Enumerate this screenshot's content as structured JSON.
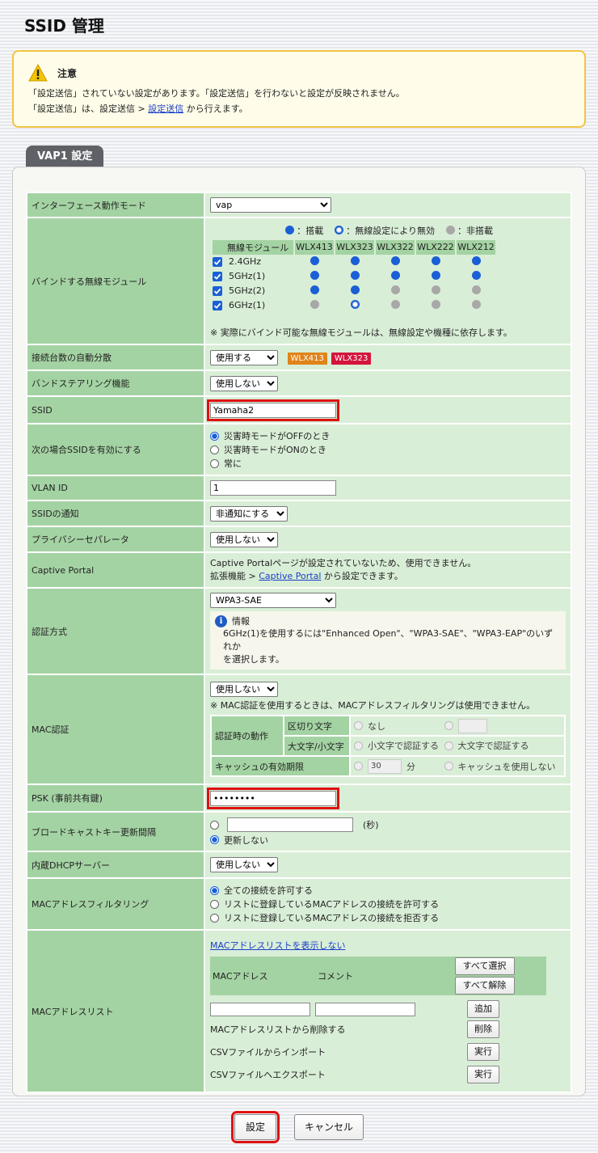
{
  "title": "SSID 管理",
  "notice": {
    "title": "注意",
    "line1": "「設定送信」されていない設定があります。「設定送信」を行わないと設定が反映されません。",
    "line2_pre": "「設定送信」は、設定送信 > ",
    "line2_link": "設定送信",
    "line2_post": " から行えます。"
  },
  "tab": "VAP1 設定",
  "colors": {
    "accent": "#1a5fd6",
    "label_bg": "#a4d3a3",
    "value_bg": "#d9eed7",
    "highlight": "#e01010",
    "badge_orange": "#e0841a",
    "badge_red": "#d4143c"
  },
  "rows": {
    "iface_mode": {
      "label": "インターフェース動作モード",
      "value": "vap"
    },
    "bind": {
      "label": "バインドする無線モジュール",
      "legend": {
        "mounted": "：搭載",
        "disabled": "：無線設定により無効",
        "none": "：非搭載"
      },
      "header": [
        "無線モジュール",
        "WLX413",
        "WLX323",
        "WLX322",
        "WLX222",
        "WLX212"
      ],
      "bands": [
        {
          "name": "2.4GHz",
          "status": [
            "blue",
            "blue",
            "blue",
            "blue",
            "blue"
          ]
        },
        {
          "name": "5GHz(1)",
          "status": [
            "blue",
            "blue",
            "blue",
            "blue",
            "blue"
          ]
        },
        {
          "name": "5GHz(2)",
          "status": [
            "blue",
            "blue",
            "gray",
            "gray",
            "gray"
          ]
        },
        {
          "name": "6GHz(1)",
          "status": [
            "gray",
            "ring",
            "gray",
            "gray",
            "gray"
          ]
        }
      ],
      "note": "※ 実際にバインド可能な無線モジュールは、無線設定や機種に依存します。"
    },
    "auto_distrib": {
      "label": "接続台数の自動分散",
      "value": "使用する",
      "badges": [
        "WLX413",
        "WLX323"
      ]
    },
    "band_steering": {
      "label": "バンドステアリング機能",
      "value": "使用しない"
    },
    "ssid": {
      "label": "SSID",
      "value": "Yamaha2"
    },
    "ssid_enable": {
      "label": "次の場合SSIDを有効にする",
      "options": [
        "災害時モードがOFFのとき",
        "災害時モードがONのとき",
        "常に"
      ]
    },
    "vlan": {
      "label": "VLAN ID",
      "value": "1"
    },
    "ssid_notify": {
      "label": "SSIDの通知",
      "value": "非通知にする"
    },
    "privacy": {
      "label": "プライバシーセパレータ",
      "value": "使用しない"
    },
    "captive": {
      "label": "Captive Portal",
      "line1": "Captive Portalページが設定されていないため、使用できません。",
      "line2_pre": "拡張機能 > ",
      "line2_link": "Captive Portal",
      "line2_post": " から設定できます。"
    },
    "auth": {
      "label": "認証方式",
      "value": "WPA3-SAE",
      "info_title": "情報",
      "info_line1": "6GHz(1)を使用するには\"Enhanced Open\"、\"WPA3-SAE\"、\"WPA3-EAP\"のいずれか",
      "info_line2": "を選択します。"
    },
    "mac_auth": {
      "label": "MAC認証",
      "value": "使用しない",
      "note": "※ MAC認証を使用するときは、MACアドレスフィルタリングは使用できません。",
      "behavior": "認証時の動作",
      "delimiter": "区切り文字",
      "delim_none": "なし",
      "case": "大文字/小文字",
      "case_lower": "小文字で認証する",
      "case_upper": "大文字で認証する",
      "cache": "キャッシュの有効期限",
      "cache_value": "30",
      "cache_unit": "分",
      "cache_off": "キャッシュを使用しない"
    },
    "psk": {
      "label": "PSK (事前共有鍵)",
      "value": "••••••••"
    },
    "bcast": {
      "label": "ブロードキャストキー更新間隔",
      "unit": "(秒)",
      "no_update": "更新しない"
    },
    "dhcp": {
      "label": "内蔵DHCPサーバー",
      "value": "使用しない"
    },
    "mac_filter": {
      "label": "MACアドレスフィルタリング",
      "options": [
        "全ての接続を許可する",
        "リストに登録しているMACアドレスの接続を許可する",
        "リストに登録しているMACアドレスの接続を拒否する"
      ]
    },
    "mac_list": {
      "label": "MACアドレスリスト",
      "toggle_link": "MACアドレスリストを表示しない",
      "col_mac": "MACアドレス",
      "col_comment": "コメント",
      "select_all": "すべて選択",
      "deselect_all": "すべて解除",
      "add": "追加",
      "delete_label": "MACアドレスリストから削除する",
      "delete_btn": "削除",
      "import_label": "CSVファイルからインポート",
      "import_btn": "実行",
      "export_label": "CSVファイルへエクスポート",
      "export_btn": "実行"
    }
  },
  "buttons": {
    "submit": "設定",
    "cancel": "キャンセル"
  }
}
